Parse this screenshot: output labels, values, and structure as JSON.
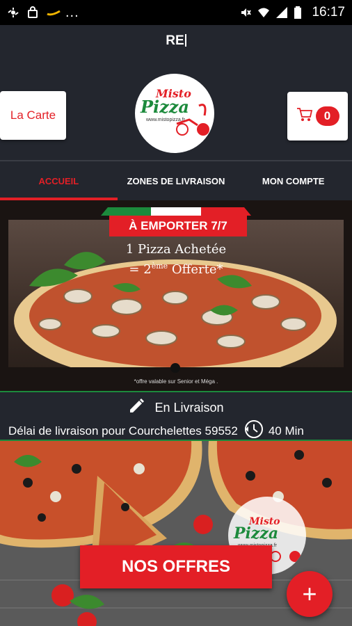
{
  "status_bar": {
    "time": "16:17",
    "overflow_dots": "...",
    "left_icons": [
      "sync-icon",
      "bag-icon",
      "key-icon"
    ],
    "right_icons": [
      "mute-icon",
      "wifi-icon",
      "signal-icon",
      "battery-icon"
    ]
  },
  "header": {
    "title": "RE",
    "menu_button_label": "La Carte",
    "cart_count": "0",
    "logo": {
      "word1": "Misto",
      "word2": "Pizza",
      "url": "www.mistopizza.fr"
    }
  },
  "tabs": [
    {
      "label": "ACCUEIL",
      "active": true
    },
    {
      "label": "ZONES DE LIVRAISON",
      "active": false
    },
    {
      "label": "MON COMPTE",
      "active": false
    }
  ],
  "banner": {
    "tag": "À EMPORTER 7/7",
    "line1": "1 Pizza Achetée",
    "line2_prefix": "= 2",
    "line2_sup": "ème",
    "line2_suffix": " Offerte*",
    "note": "*offre valable sur Senior et Méga ."
  },
  "delivery": {
    "mode": "En Livraison",
    "description": "Délai de livraison pour Courchelettes 59552",
    "time": "40 Min"
  },
  "promo": {
    "button_label": "NOS OFFRES",
    "fab_label": "+"
  },
  "colors": {
    "accent": "#e31f26",
    "background": "#23262e",
    "green": "#1c8a3c"
  }
}
